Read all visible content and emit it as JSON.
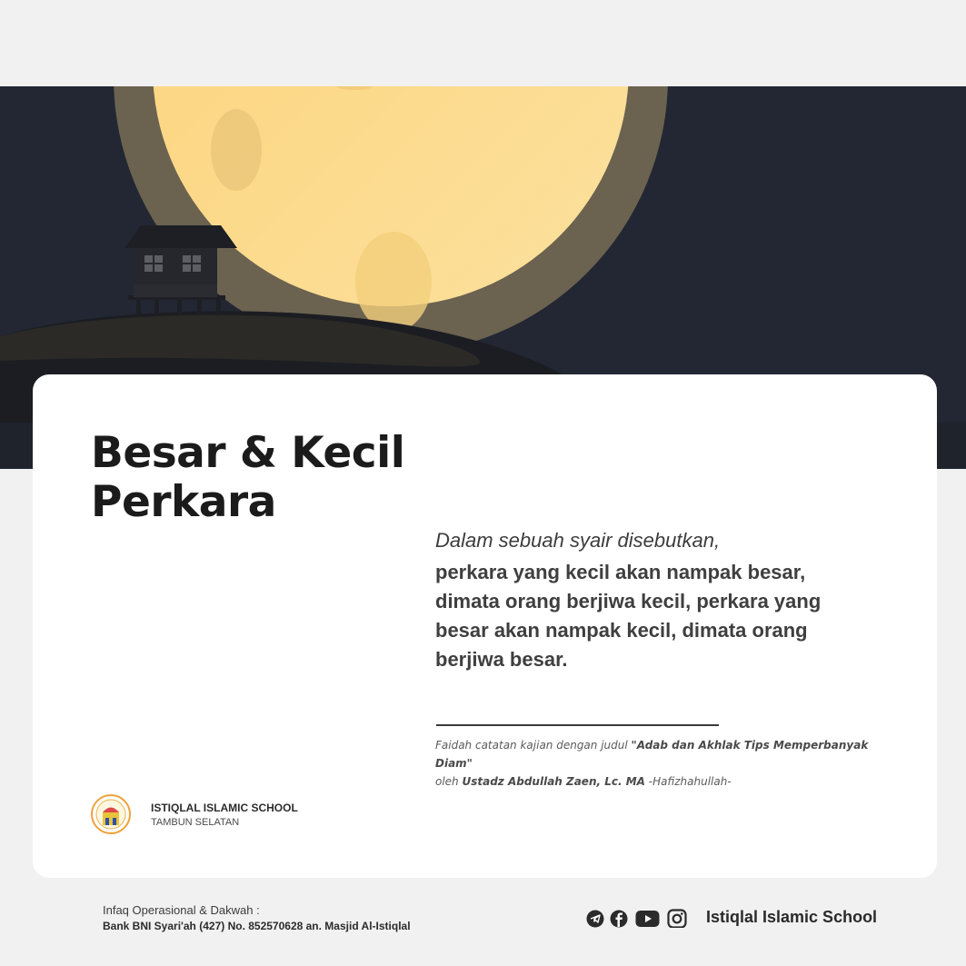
{
  "post": {
    "title_line1": "Besar & Kecil",
    "title_line2": "Perkara",
    "quote_intro": "Dalam sebuah syair disebutkan,",
    "quote_body": "perkara yang kecil akan nampak besar, dimata orang berjiwa kecil, perkara yang besar akan nampak kecil, dimata orang berjiwa besar.",
    "source_prefix": "Faidah catatan kajian dengan judul ",
    "source_title": "\"Adab dan Akhlak Tips Memperbanyak Diam\"",
    "source_by": "oleh ",
    "source_speaker": "Ustadz Abdullah Zaen, Lc. MA",
    "source_suffix": " -Hafizhahullah-"
  },
  "school": {
    "name": "ISTIQLAL ISLAMIC SCHOOL",
    "location": "TAMBUN SELATAN",
    "logo_icon": "school-logo-icon"
  },
  "footer": {
    "infaq_label": "Infaq Operasional & Dakwah :",
    "bank_info": "Bank BNI Syari'ah (427) No. 852570628 an. Masjid Al-Istiqlal",
    "brand": "Istiqlal Islamic School",
    "social_icons": [
      "telegram-icon",
      "facebook-icon",
      "youtube-icon",
      "instagram-icon"
    ]
  },
  "colors": {
    "background": "#f1f1f1",
    "night_sky": "#222733",
    "moon": "#fddc84",
    "moon_halo": "#6b6250",
    "card": "#ffffff",
    "text_dark": "#1b1b1b"
  }
}
